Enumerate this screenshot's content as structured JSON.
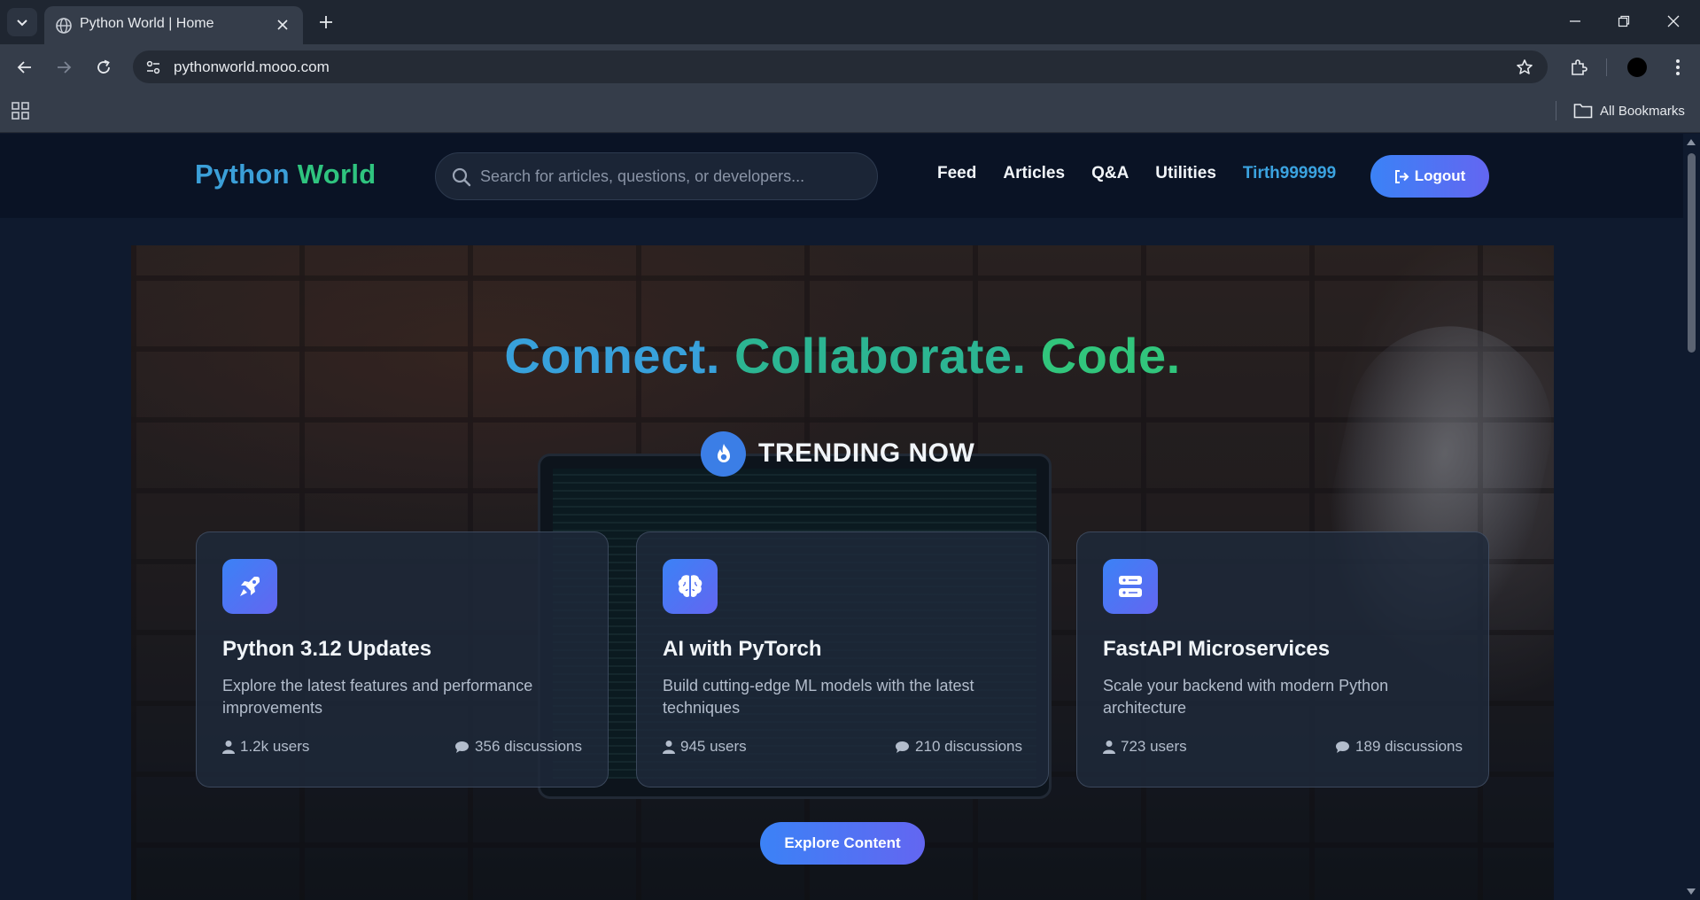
{
  "browser": {
    "tab_title": "Python World | Home",
    "url": "pythonworld.mooo.com",
    "bookmarks_label": "All Bookmarks"
  },
  "site": {
    "logo_part1": "Python",
    "logo_part2": "World",
    "search_placeholder": "Search for articles, questions, or developers...",
    "nav": {
      "feed": "Feed",
      "articles": "Articles",
      "qa": "Q&A",
      "utilities": "Utilities",
      "user": "Tirth999999"
    },
    "logout_label": "Logout"
  },
  "hero": {
    "headline": {
      "part1": "Connect.",
      "part2": "Collaborate.",
      "part3": "Code."
    },
    "trending_label": "TRENDING NOW",
    "explore_label": "Explore Content"
  },
  "cards": [
    {
      "icon": "rocket-icon",
      "title": "Python 3.12 Updates",
      "description": "Explore the latest features and performance improvements",
      "users": "1.2k users",
      "discussions": "356 discussions"
    },
    {
      "icon": "brain-icon",
      "title": "AI with PyTorch",
      "description": "Build cutting-edge ML models with the latest techniques",
      "users": "945 users",
      "discussions": "210 discussions"
    },
    {
      "icon": "server-icon",
      "title": "FastAPI Microservices",
      "description": "Scale your backend with modern Python architecture",
      "users": "723 users",
      "discussions": "189 discussions"
    }
  ],
  "colors": {
    "accent_blue": "#3b82f6",
    "accent_indigo": "#6366f1",
    "logo_blue": "#3b9fd8",
    "logo_green": "#2fc47f",
    "page_bg": "#0f1a2e"
  }
}
